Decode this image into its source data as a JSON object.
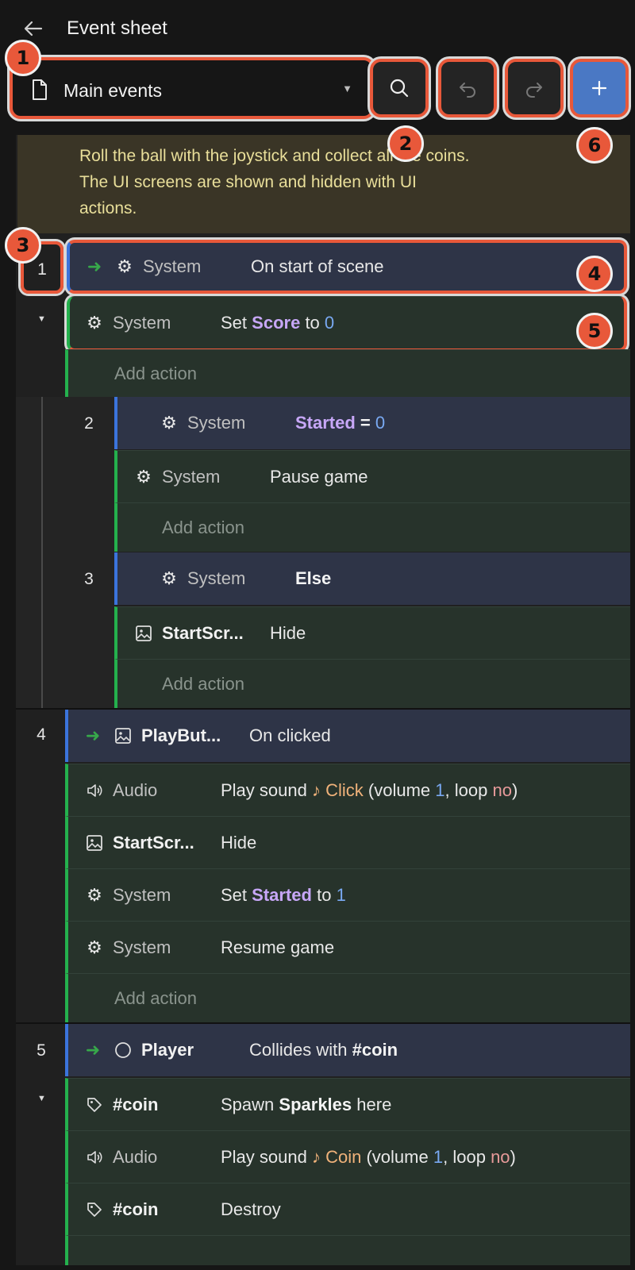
{
  "header": {
    "title": "Event sheet"
  },
  "toolbar": {
    "sheet_name": "Main events"
  },
  "callouts": [
    "1",
    "2",
    "3",
    "4",
    "5",
    "6"
  ],
  "comment": {
    "line1": "Roll the ball with the joystick and collect all the coins.",
    "line2": "The UI screens are shown and hidden with UI",
    "line3": "actions."
  },
  "events": [
    {
      "num": "1",
      "cond_obj": "System",
      "cond_text": "On start of scene",
      "a1_obj": "System",
      "a1_set": "Set",
      "a1_var": "Score",
      "a1_to": "to",
      "a1_val": "0",
      "add": "Add action"
    },
    {
      "num": "2",
      "cond_obj": "System",
      "cond_var": "Started",
      "cond_eq": "=",
      "cond_val": "0",
      "a1_obj": "System",
      "a1_text": "Pause game",
      "add": "Add action"
    },
    {
      "num": "3",
      "cond_obj": "System",
      "cond_text": "Else",
      "a1_obj": "StartScr...",
      "a1_text": "Hide",
      "add": "Add action"
    },
    {
      "num": "4",
      "cond_obj": "PlayBut...",
      "cond_text": "On clicked",
      "a1_obj": "Audio",
      "a1_play": "Play sound",
      "a1_note": "♪",
      "a1_sound": "Click",
      "a1_p1": "(volume",
      "a1_vol": "1",
      "a1_p2": ", loop",
      "a1_loop": "no",
      "a1_p3": ")",
      "a2_obj": "StartScr...",
      "a2_text": "Hide",
      "a3_obj": "System",
      "a3_set": "Set",
      "a3_var": "Started",
      "a3_to": "to",
      "a3_val": "1",
      "a4_obj": "System",
      "a4_text": "Resume game",
      "add": "Add action"
    },
    {
      "num": "5",
      "cond_obj": "Player",
      "cond_text": "Collides with",
      "cond_tag": "#coin",
      "a1_obj": "#coin",
      "a1_spawn": "Spawn",
      "a1_what": "Sparkles",
      "a1_here": "here",
      "a2_obj": "Audio",
      "a2_play": "Play sound",
      "a2_note": "♪",
      "a2_sound": "Coin",
      "a2_p1": "(volume",
      "a2_vol": "1",
      "a2_p2": ", loop",
      "a2_loop": "no",
      "a2_p3": ")",
      "a3_obj": "#coin",
      "a3_text": "Destroy"
    }
  ],
  "colors": {
    "accent": "#e8583a",
    "add_button": "#4a78c4",
    "condition_bar": "#3b74dc",
    "action_bar": "#24b14d"
  }
}
